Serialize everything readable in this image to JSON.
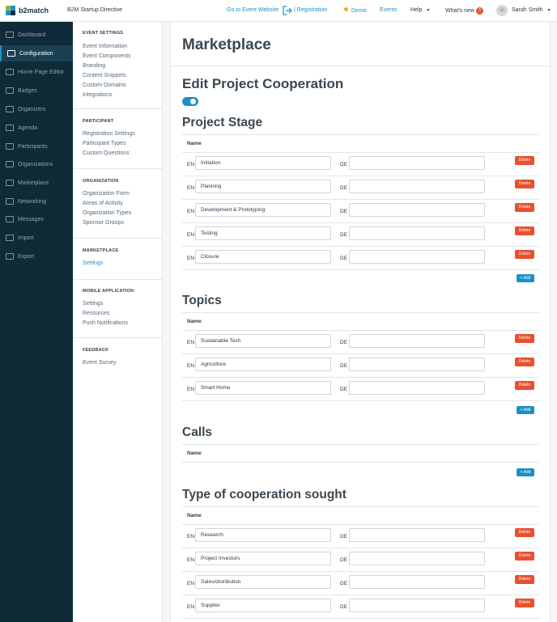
{
  "header": {
    "logo_text": "b2match",
    "event_name": "B2M Startup Directive",
    "goto_event": "Go to Event Website",
    "registration": "Registration",
    "demo": "Demo",
    "events": "Events",
    "help": "Help",
    "whats_new": "What's new",
    "whats_new_count": "3",
    "user_name": "Sarah Smith",
    "accent": "#1e8fc6"
  },
  "sidebar": {
    "items": [
      {
        "label": "Dashboard",
        "icon": "dashboard-icon"
      },
      {
        "label": "Configuration",
        "icon": "wrench-icon"
      },
      {
        "label": "Home Page Editor",
        "icon": "monitor-icon"
      },
      {
        "label": "Badges",
        "icon": "badge-icon"
      },
      {
        "label": "Organizers",
        "icon": "users-icon"
      },
      {
        "label": "Agenda",
        "icon": "calendar-icon"
      },
      {
        "label": "Participants",
        "icon": "participants-icon"
      },
      {
        "label": "Organizations",
        "icon": "building-icon"
      },
      {
        "label": "Marketplace",
        "icon": "grid-icon"
      },
      {
        "label": "Networking",
        "icon": "network-icon"
      },
      {
        "label": "Messages",
        "icon": "envelope-icon"
      },
      {
        "label": "Import",
        "icon": "import-icon"
      },
      {
        "label": "Export",
        "icon": "export-icon"
      }
    ]
  },
  "subnav": {
    "event_settings": {
      "title": "EVENT SETTINGS",
      "links": [
        "Event Information",
        "Event Components",
        "Branding",
        "Content Snippets",
        "Custom Domains",
        "Integrations"
      ]
    },
    "participant": {
      "title": "PARTICIPANT",
      "links": [
        "Registration Settings",
        "Participant Types",
        "Custom Questions"
      ]
    },
    "organization": {
      "title": "ORGANIZATION",
      "links": [
        "Organization Form",
        "Areas of Activity",
        "Organization Types",
        "Sponsor Groups"
      ]
    },
    "marketplace": {
      "title": "MARKETPLACE",
      "links": [
        "Settings"
      ]
    },
    "mobile": {
      "title": "MOBILE APPLICATION",
      "links": [
        "Settings",
        "Resources",
        "Push Notifications"
      ]
    },
    "feedback": {
      "title": "FEEDBACK",
      "links": [
        "Event Survey"
      ]
    }
  },
  "main": {
    "page_title": "Marketplace",
    "section_title": "Edit Project Cooperation",
    "toggle_on": true,
    "name_header": "Name",
    "en": "EN",
    "de": "DE",
    "delete_label": "Delete",
    "add_label": "+ Add",
    "project_stage": {
      "title": "Project Stage",
      "items": [
        "Initiation",
        "Planning",
        "Development & Prototyping",
        "Testing",
        "Closure"
      ]
    },
    "topics": {
      "title": "Topics",
      "items": [
        "Sustainable Tech",
        "Agriculture",
        "Smart Home"
      ]
    },
    "calls": {
      "title": "Calls",
      "items": []
    },
    "cooperation": {
      "title": "Type of cooperation sought",
      "items": [
        "Research",
        "Project Investors",
        "Sales/distribution",
        "Supplier"
      ]
    }
  }
}
